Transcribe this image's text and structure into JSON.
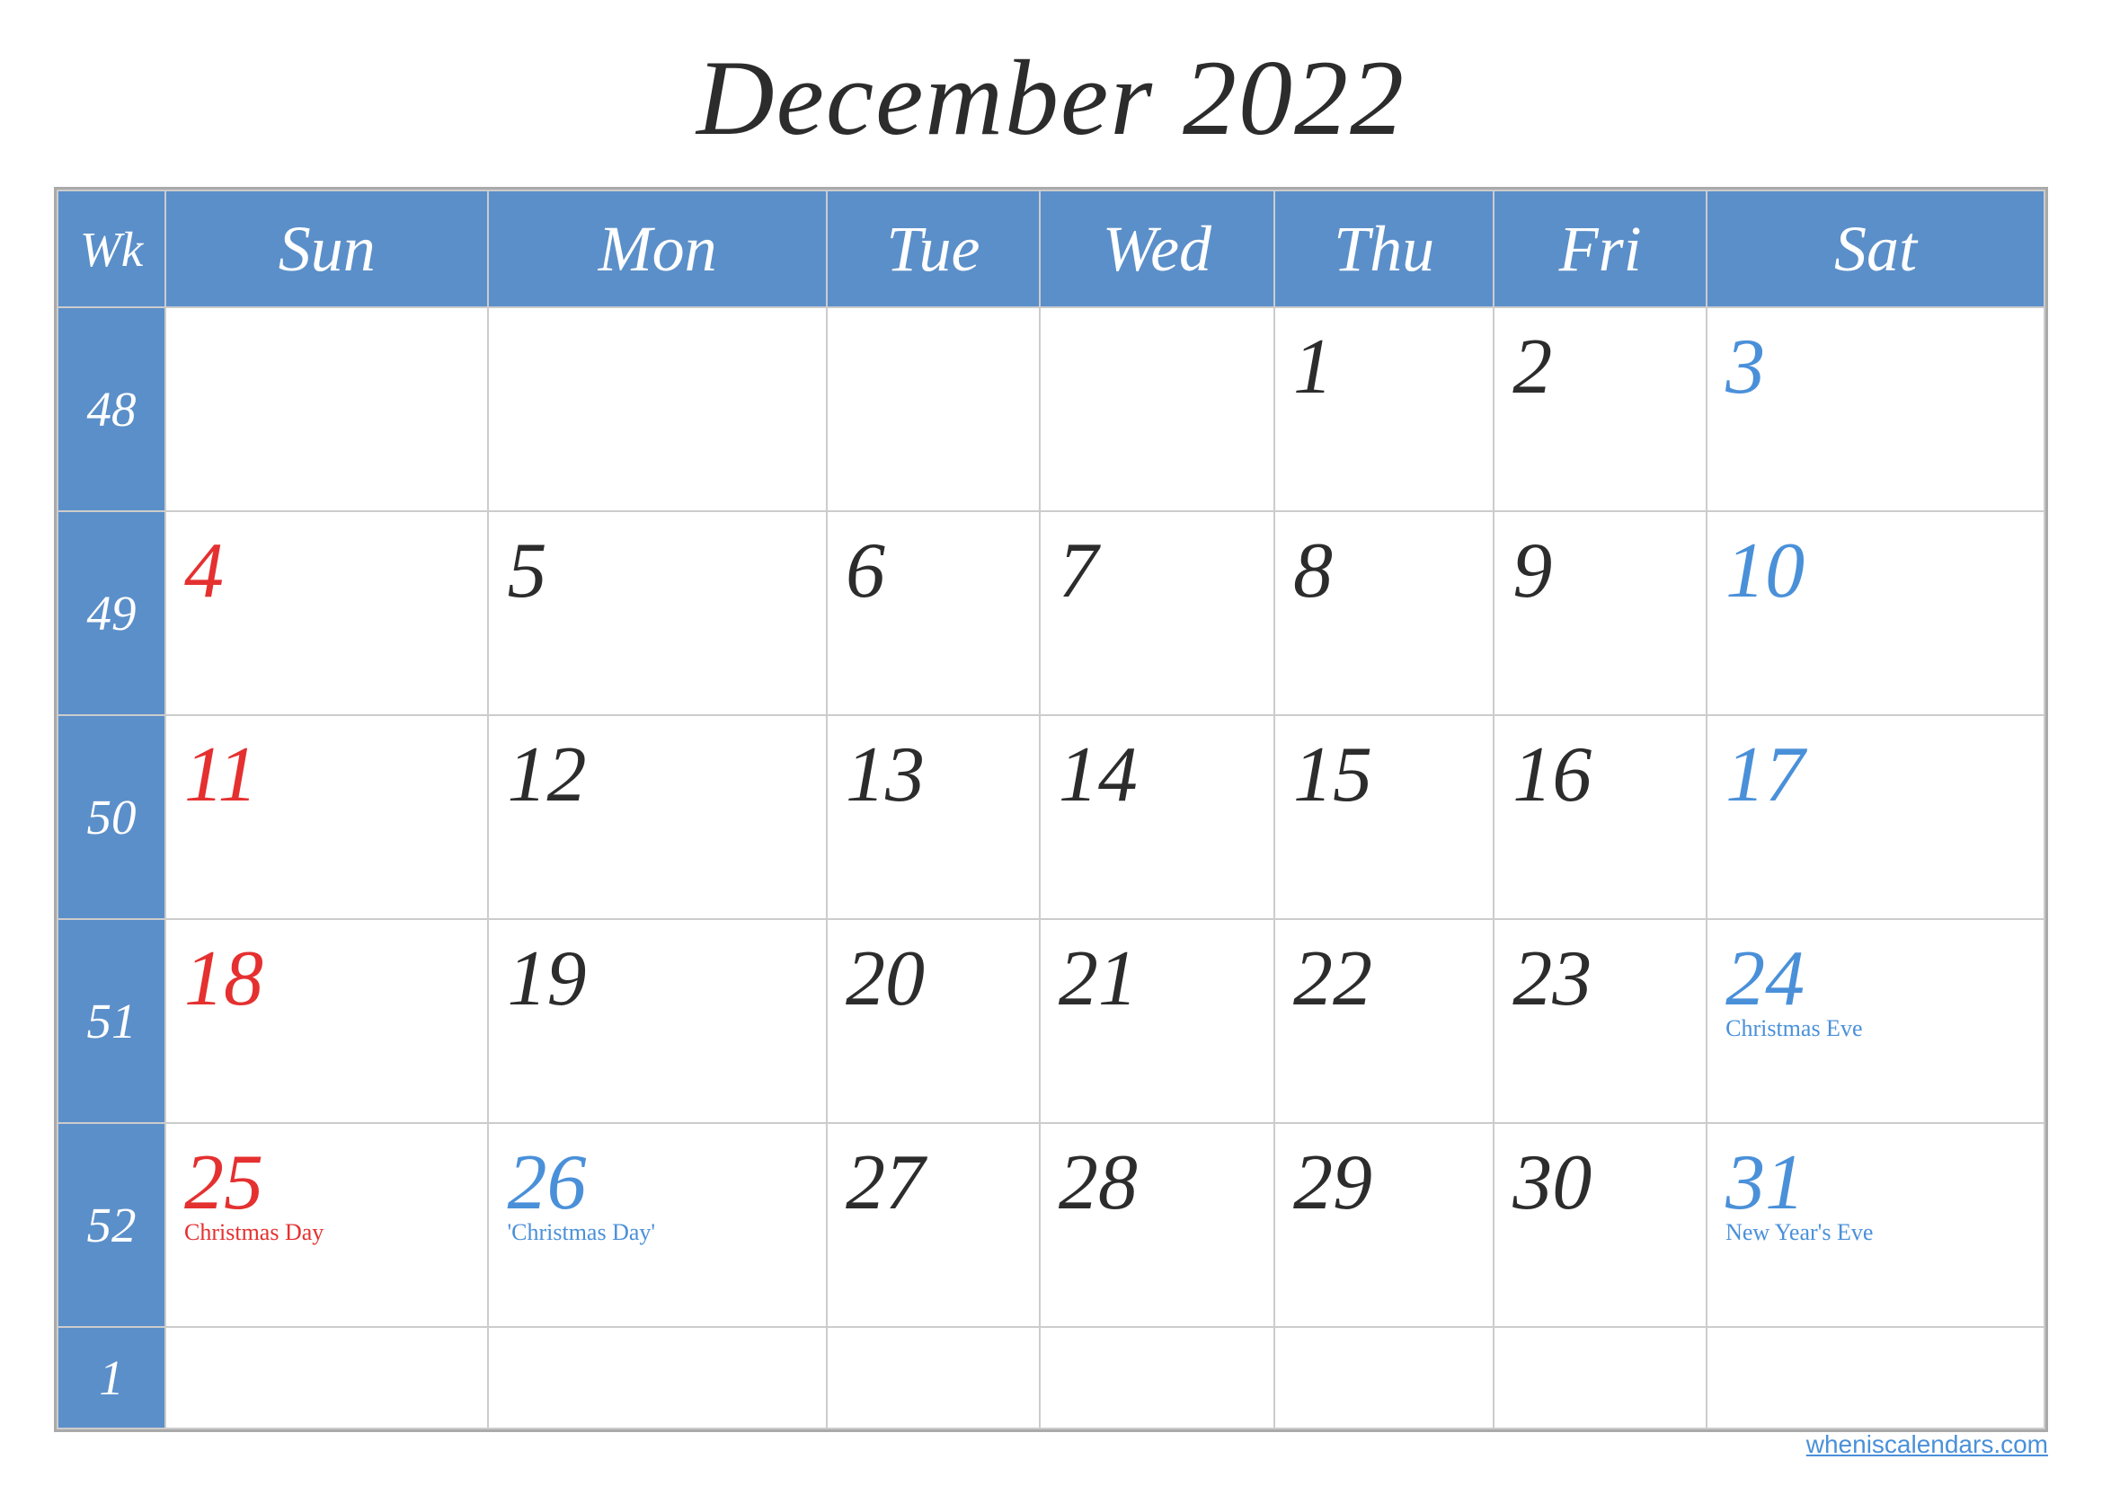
{
  "title": "December 2022",
  "headers": {
    "wk": "Wk",
    "sun": "Sun",
    "mon": "Mon",
    "tue": "Tue",
    "wed": "Wed",
    "thu": "Thu",
    "fri": "Fri",
    "sat": "Sat"
  },
  "weeks": [
    {
      "wk": "48",
      "days": [
        {
          "num": "",
          "label": "",
          "color": "dark",
          "col": "sun"
        },
        {
          "num": "",
          "label": "",
          "color": "dark",
          "col": "mon"
        },
        {
          "num": "",
          "label": "",
          "color": "dark",
          "col": "tue"
        },
        {
          "num": "",
          "label": "",
          "color": "dark",
          "col": "wed"
        },
        {
          "num": "1",
          "label": "",
          "color": "dark",
          "col": "thu"
        },
        {
          "num": "2",
          "label": "",
          "color": "dark",
          "col": "fri"
        },
        {
          "num": "3",
          "label": "",
          "color": "blue",
          "col": "sat"
        }
      ]
    },
    {
      "wk": "49",
      "days": [
        {
          "num": "4",
          "label": "",
          "color": "red",
          "col": "sun"
        },
        {
          "num": "5",
          "label": "",
          "color": "dark",
          "col": "mon"
        },
        {
          "num": "6",
          "label": "",
          "color": "dark",
          "col": "tue"
        },
        {
          "num": "7",
          "label": "",
          "color": "dark",
          "col": "wed"
        },
        {
          "num": "8",
          "label": "",
          "color": "dark",
          "col": "thu"
        },
        {
          "num": "9",
          "label": "",
          "color": "dark",
          "col": "fri"
        },
        {
          "num": "10",
          "label": "",
          "color": "blue",
          "col": "sat"
        }
      ]
    },
    {
      "wk": "50",
      "days": [
        {
          "num": "11",
          "label": "",
          "color": "red",
          "col": "sun"
        },
        {
          "num": "12",
          "label": "",
          "color": "dark",
          "col": "mon"
        },
        {
          "num": "13",
          "label": "",
          "color": "dark",
          "col": "tue"
        },
        {
          "num": "14",
          "label": "",
          "color": "dark",
          "col": "wed"
        },
        {
          "num": "15",
          "label": "",
          "color": "dark",
          "col": "thu"
        },
        {
          "num": "16",
          "label": "",
          "color": "dark",
          "col": "fri"
        },
        {
          "num": "17",
          "label": "",
          "color": "blue",
          "col": "sat"
        }
      ]
    },
    {
      "wk": "51",
      "days": [
        {
          "num": "18",
          "label": "",
          "color": "red",
          "col": "sun"
        },
        {
          "num": "19",
          "label": "",
          "color": "dark",
          "col": "mon"
        },
        {
          "num": "20",
          "label": "",
          "color": "dark",
          "col": "tue"
        },
        {
          "num": "21",
          "label": "",
          "color": "dark",
          "col": "wed"
        },
        {
          "num": "22",
          "label": "",
          "color": "dark",
          "col": "thu"
        },
        {
          "num": "23",
          "label": "",
          "color": "dark",
          "col": "fri"
        },
        {
          "num": "24",
          "label": "Christmas Eve",
          "color": "blue",
          "col": "sat"
        }
      ]
    },
    {
      "wk": "52",
      "days": [
        {
          "num": "25",
          "label": "Christmas Day",
          "color": "red",
          "col": "sun"
        },
        {
          "num": "26",
          "label": "'Christmas Day'",
          "color": "blue",
          "col": "mon"
        },
        {
          "num": "27",
          "label": "",
          "color": "dark",
          "col": "tue"
        },
        {
          "num": "28",
          "label": "",
          "color": "dark",
          "col": "wed"
        },
        {
          "num": "29",
          "label": "",
          "color": "dark",
          "col": "thu"
        },
        {
          "num": "30",
          "label": "",
          "color": "dark",
          "col": "fri"
        },
        {
          "num": "31",
          "label": "New Year's Eve",
          "color": "blue",
          "col": "sat"
        }
      ]
    }
  ],
  "watermark": "wheniscalendars.com",
  "extra_wk": "1"
}
